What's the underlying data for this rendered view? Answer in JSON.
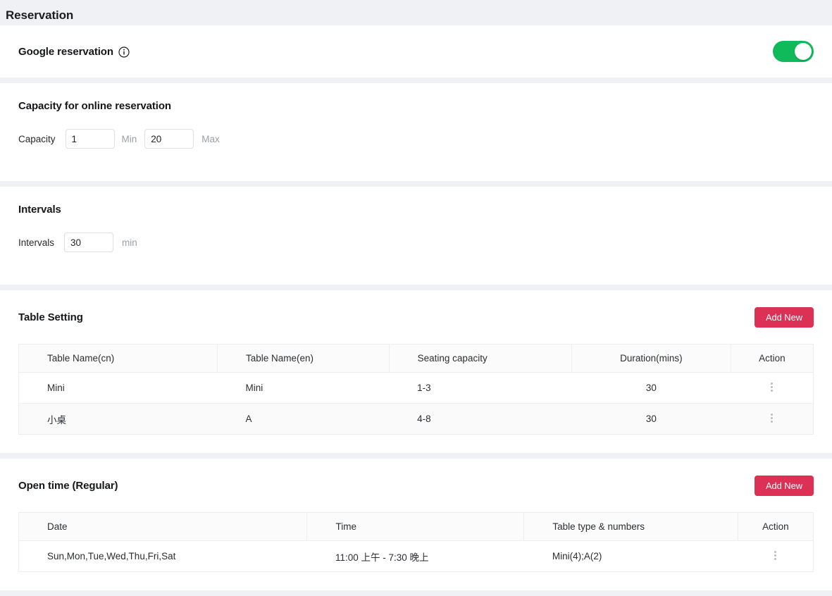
{
  "page": {
    "title": "Reservation",
    "accent_color": "#dc3055",
    "toggle_on_color": "#10b95a",
    "background_color": "#eff1f5"
  },
  "google_reservation": {
    "title": "Google reservation",
    "info_icon": "info-circle-icon",
    "toggle_state": "on"
  },
  "capacity": {
    "heading": "Capacity for online reservation",
    "label": "Capacity",
    "min_value": "1",
    "min_suffix": "Min",
    "max_value": "20",
    "max_suffix": "Max"
  },
  "intervals": {
    "heading": "Intervals",
    "label": "Intervals",
    "value": "30",
    "suffix": "min"
  },
  "table_setting": {
    "heading": "Table Setting",
    "add_button": "Add New",
    "columns": [
      "Table Name(cn)",
      "Table Name(en)",
      "Seating capacity",
      "Duration(mins)",
      "Action"
    ],
    "rows": [
      {
        "name_cn": "Mini",
        "name_en": "Mini",
        "seating": "1-3",
        "duration": "30",
        "action_icon": "kebab-menu-icon"
      },
      {
        "name_cn": "小桌",
        "name_en": "A",
        "seating": "4-8",
        "duration": "30",
        "action_icon": "kebab-menu-icon"
      }
    ]
  },
  "open_time": {
    "heading": "Open time (Regular)",
    "add_button": "Add New",
    "columns": [
      "Date",
      "Time",
      "Table type & numbers",
      "Action"
    ],
    "rows": [
      {
        "date": "Sun,Mon,Tue,Wed,Thu,Fri,Sat",
        "time": "11:00 上午 - 7:30 晚上",
        "tables": "Mini(4);A(2)",
        "action_icon": "kebab-menu-icon"
      }
    ]
  }
}
